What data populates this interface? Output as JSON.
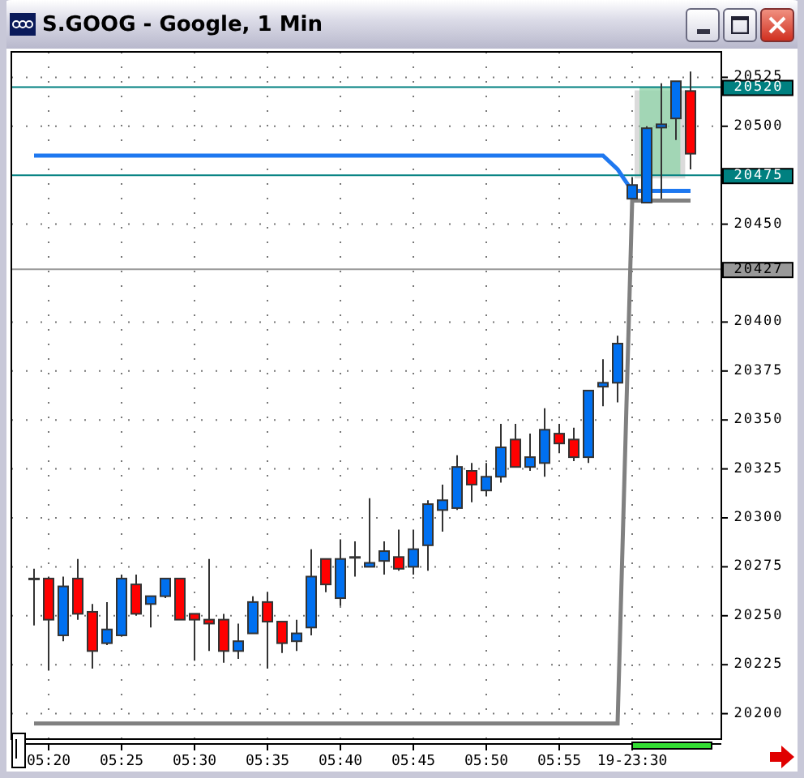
{
  "window": {
    "title": "S.GOOG - Google, 1 Min"
  },
  "chart": {
    "chart_data": {
      "type": "candlestick",
      "grid": true,
      "categories": [
        null,
        "05:20",
        null,
        null,
        null,
        null,
        "05:25",
        null,
        null,
        null,
        null,
        "05:30",
        null,
        null,
        null,
        null,
        "05:35",
        null,
        null,
        null,
        null,
        "05:40",
        null,
        null,
        null,
        null,
        "05:45",
        null,
        null,
        null,
        null,
        "05:50",
        null,
        null,
        null,
        null,
        "05:55",
        null,
        null,
        null,
        null,
        "19-23:30",
        null,
        null,
        null,
        null
      ],
      "ohlc": [
        [
          20269,
          20274,
          20245,
          20269
        ],
        [
          20269,
          20270,
          20222,
          20248
        ],
        [
          20240,
          20270,
          20237,
          20265
        ],
        [
          20269,
          20279,
          20248,
          20251
        ],
        [
          20252,
          20256,
          20223,
          20232
        ],
        [
          20236,
          20257,
          20235,
          20243
        ],
        [
          20240,
          20271,
          20240,
          20269
        ],
        [
          20266,
          20271,
          20250,
          20251
        ],
        [
          20256,
          20260,
          20244,
          20260
        ],
        [
          20260,
          20269,
          20259,
          20269
        ],
        [
          20269,
          20269,
          20248,
          20248
        ],
        [
          20251,
          20251,
          20227,
          20248
        ],
        [
          20248,
          20279,
          20232,
          20246
        ],
        [
          20248,
          20251,
          20226,
          20232
        ],
        [
          20232,
          20246,
          20228,
          20237
        ],
        [
          20241,
          20260,
          20241,
          20257
        ],
        [
          20257,
          20262,
          20223,
          20247
        ],
        [
          20247,
          20247,
          20231,
          20236
        ],
        [
          20237,
          20248,
          20232,
          20241
        ],
        [
          20244,
          20284,
          20240,
          20270
        ],
        [
          20279,
          20279,
          20262,
          20266
        ],
        [
          20259,
          20289,
          20255,
          20279
        ],
        [
          20280,
          20288,
          20270,
          20280
        ],
        [
          20275,
          20310,
          20275,
          20277
        ],
        [
          20278,
          20288,
          20271,
          20283
        ],
        [
          20280,
          20294,
          20273,
          20274
        ],
        [
          20275,
          20294,
          20271,
          20284
        ],
        [
          20286,
          20309,
          20273,
          20307
        ],
        [
          20304,
          20317,
          20293,
          20309
        ],
        [
          20305,
          20332,
          20304,
          20326
        ],
        [
          20324,
          20328,
          20308,
          20317
        ],
        [
          20314,
          20328,
          20311,
          20321
        ],
        [
          20321,
          20348,
          20318,
          20336
        ],
        [
          20340,
          20348,
          20326,
          20326
        ],
        [
          20326,
          20343,
          20324,
          20331
        ],
        [
          20328,
          20356,
          20321,
          20345
        ],
        [
          20343,
          20348,
          20333,
          20338
        ],
        [
          20340,
          20346,
          20329,
          20331
        ],
        [
          20331,
          20365,
          20328,
          20365
        ],
        [
          20367,
          20381,
          20357,
          20369
        ],
        [
          20369,
          20393,
          20359,
          20389
        ],
        [
          20463,
          20474,
          20463,
          20470
        ],
        [
          20461,
          20500,
          20461,
          20499
        ],
        [
          20500,
          20522,
          20463,
          20501
        ],
        [
          20504,
          20523,
          20493,
          20523
        ],
        [
          20518,
          20528,
          20478,
          20486
        ]
      ],
      "series": [
        {
          "type": "line",
          "color": "#1e78f0",
          "values": [
            20485,
            20485,
            20485,
            20485,
            20485,
            20485,
            20485,
            20485,
            20485,
            20485,
            20485,
            20485,
            20485,
            20485,
            20485,
            20485,
            20485,
            20485,
            20485,
            20485,
            20485,
            20485,
            20485,
            20485,
            20485,
            20485,
            20485,
            20485,
            20485,
            20485,
            20485,
            20485,
            20485,
            20485,
            20485,
            20485,
            20485,
            20485,
            20485,
            20485,
            20478,
            20467,
            20467,
            20467,
            20467,
            20467
          ]
        },
        {
          "type": "line",
          "color": "#808080",
          "values": [
            20195,
            20195,
            20195,
            20195,
            20195,
            20195,
            20195,
            20195,
            20195,
            20195,
            20195,
            20195,
            20195,
            20195,
            20195,
            20195,
            20195,
            20195,
            20195,
            20195,
            20195,
            20195,
            20195,
            20195,
            20195,
            20195,
            20195,
            20195,
            20195,
            20195,
            20195,
            20195,
            20195,
            20195,
            20195,
            20195,
            20195,
            20195,
            20195,
            20195,
            20195,
            20462,
            20462,
            20462,
            20462,
            20462
          ]
        }
      ],
      "ylim": [
        20187,
        20538
      ],
      "yticks": [
        20200,
        20225,
        20250,
        20275,
        20300,
        20325,
        20350,
        20375,
        20400,
        20450,
        20500,
        20525
      ],
      "ref_lines": [
        {
          "axis": "y",
          "value": 20520,
          "label": "20520",
          "color": "#008080"
        },
        {
          "axis": "y",
          "value": 20475,
          "label": "20475",
          "color": "#008080"
        },
        {
          "axis": "y",
          "value": 20427,
          "label": "20427",
          "color": "#999999"
        }
      ],
      "bands": [
        {
          "axis": "y",
          "from": 20475,
          "to": 20520
        }
      ]
    }
  }
}
